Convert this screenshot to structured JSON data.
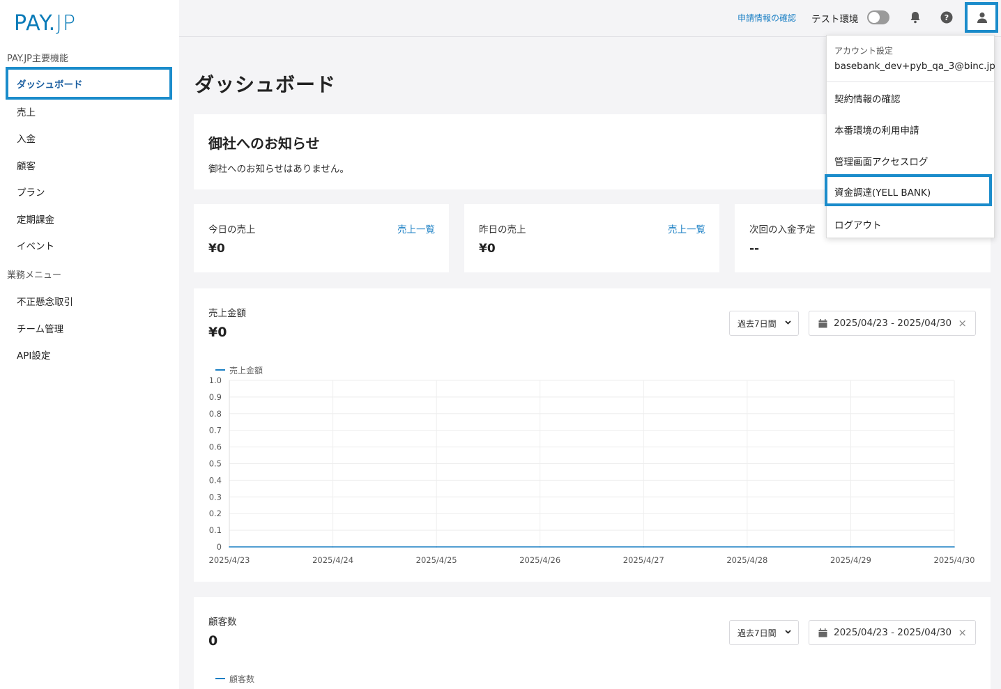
{
  "brand": {
    "logo_main": "PAY",
    "logo_dot": ".",
    "logo_suffix": "JP"
  },
  "sidebar": {
    "section1": "PAY.JP主要機能",
    "items1": [
      {
        "label": "ダッシュボード"
      },
      {
        "label": "売上"
      },
      {
        "label": "入金"
      },
      {
        "label": "顧客"
      },
      {
        "label": "プラン"
      },
      {
        "label": "定期課金"
      },
      {
        "label": "イベント"
      }
    ],
    "section2": "業務メニュー",
    "items2": [
      {
        "label": "不正懸念取引"
      },
      {
        "label": "チーム管理"
      },
      {
        "label": "API設定"
      }
    ]
  },
  "header": {
    "application_link": "申請情報の確認",
    "env_label": "テスト環境",
    "icons": [
      "bell-icon",
      "help-icon",
      "user-icon"
    ]
  },
  "page": {
    "title": "ダッシュボード"
  },
  "notice": {
    "title": "御社へのお知らせ",
    "text": "御社へのお知らせはありません。"
  },
  "stats": [
    {
      "label": "今日の売上",
      "link": "売上一覧",
      "value": "¥0"
    },
    {
      "label": "昨日の売上",
      "link": "売上一覧",
      "value": "¥0"
    },
    {
      "label": "次回の入金予定",
      "value": "--"
    }
  ],
  "sales_chart": {
    "label": "売上金額",
    "value": "¥0",
    "period_select": "過去7日間",
    "date_range": "2025/04/23 - 2025/04/30"
  },
  "customers_chart": {
    "label": "顧客数",
    "value": "0",
    "period_select": "過去7日間",
    "date_range": "2025/04/23 - 2025/04/30",
    "legend": "顧客数"
  },
  "chart_data": {
    "type": "line",
    "x": [
      "2025/4/23",
      "2025/4/24",
      "2025/4/25",
      "2025/4/26",
      "2025/4/27",
      "2025/4/28",
      "2025/4/29",
      "2025/4/30"
    ],
    "series": [
      {
        "name": "売上金額",
        "values": [
          0,
          0,
          0,
          0,
          0,
          0,
          0,
          0
        ]
      }
    ],
    "yticks": [
      "1.0",
      "0.9",
      "0.8",
      "0.7",
      "0.6",
      "0.5",
      "0.4",
      "0.3",
      "0.2",
      "0.1",
      "0"
    ],
    "ylim": [
      0,
      1
    ],
    "grid": true,
    "legend": "top-left",
    "color": "#1a7fc4"
  },
  "account_menu": {
    "header_label": "アカウント設定",
    "email": "basebank_dev+pyb_qa_3@binc.jp",
    "items": [
      {
        "label": "契約情報の確認"
      },
      {
        "label": "本番環境の利用申請"
      },
      {
        "label": "管理画面アクセスログ"
      },
      {
        "label": "資金調達(YELL BANK)"
      },
      {
        "label": "ログアウト"
      }
    ]
  }
}
